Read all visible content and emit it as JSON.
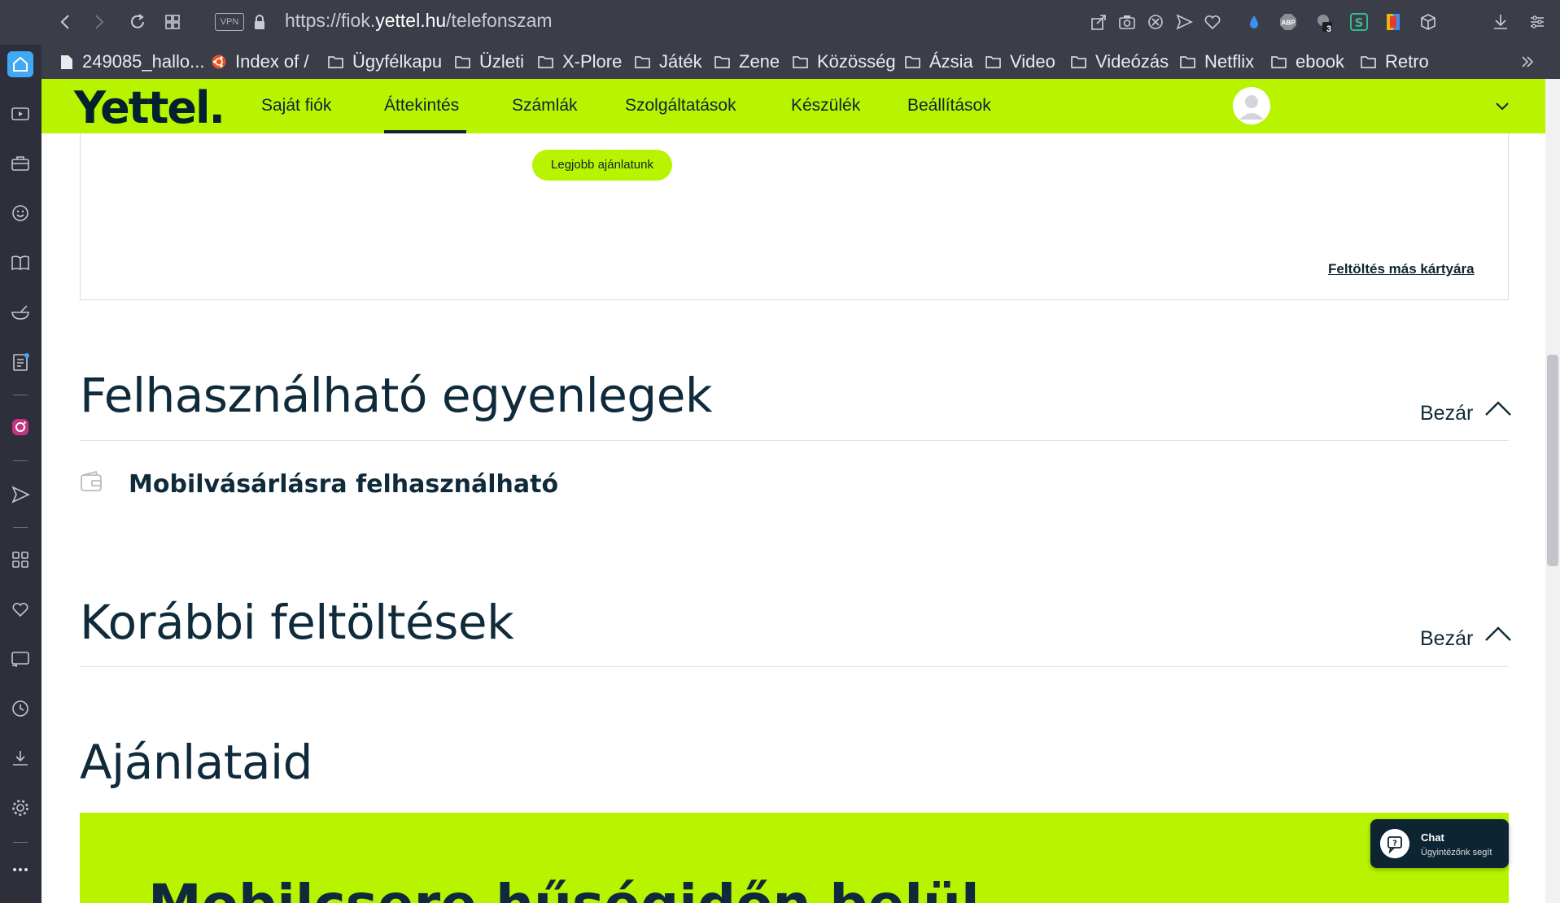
{
  "browser": {
    "url_prefix": "https://fiok.",
    "url_domain": "yettel.hu",
    "url_path": "/telefonszam",
    "vpn_label": "VPN",
    "extension_badge": "3",
    "abp_label": "ABP"
  },
  "bookmarks": [
    {
      "label": "249085_hallo...",
      "icon": "page-icon"
    },
    {
      "label": "Index of /",
      "icon": "ubuntu-icon"
    },
    {
      "label": "Ügyfélkapu",
      "icon": "folder-icon"
    },
    {
      "label": "Üzleti",
      "icon": "folder-icon"
    },
    {
      "label": "X-Plore",
      "icon": "folder-icon"
    },
    {
      "label": "Játék",
      "icon": "folder-icon"
    },
    {
      "label": "Zene",
      "icon": "folder-icon"
    },
    {
      "label": "Közösség",
      "icon": "folder-icon"
    },
    {
      "label": "Ázsia",
      "icon": "folder-icon"
    },
    {
      "label": "Video",
      "icon": "folder-icon"
    },
    {
      "label": "Videózás",
      "icon": "folder-icon"
    },
    {
      "label": "Netflix",
      "icon": "folder-icon"
    },
    {
      "label": "ebook",
      "icon": "folder-icon"
    },
    {
      "label": "Retro",
      "icon": "folder-icon"
    }
  ],
  "site": {
    "logo": "Yettel.",
    "nav": [
      "Saját fiók",
      "Áttekintés",
      "Számlák",
      "Szolgáltatások",
      "Készülék",
      "Beállítások"
    ],
    "active_nav": "Áttekintés",
    "brand_color": "#b8f400",
    "text_color": "#0f2a3a"
  },
  "topup_card": {
    "pill": "Legjobb ajánlatunk",
    "link": "Feltöltés más kártyára"
  },
  "balances": {
    "title": "Felhasználható egyenlegek",
    "close_label": "Bezár",
    "item": "Mobilvásárlásra felhasználható"
  },
  "history": {
    "title": "Korábbi feltöltések",
    "close_label": "Bezár"
  },
  "offers": {
    "title": "Ajánlataid",
    "promo_title": "Mobilcsere hűségidőn belül"
  },
  "chat": {
    "title": "Chat",
    "subtitle": "Ügyintézőnk segít"
  }
}
